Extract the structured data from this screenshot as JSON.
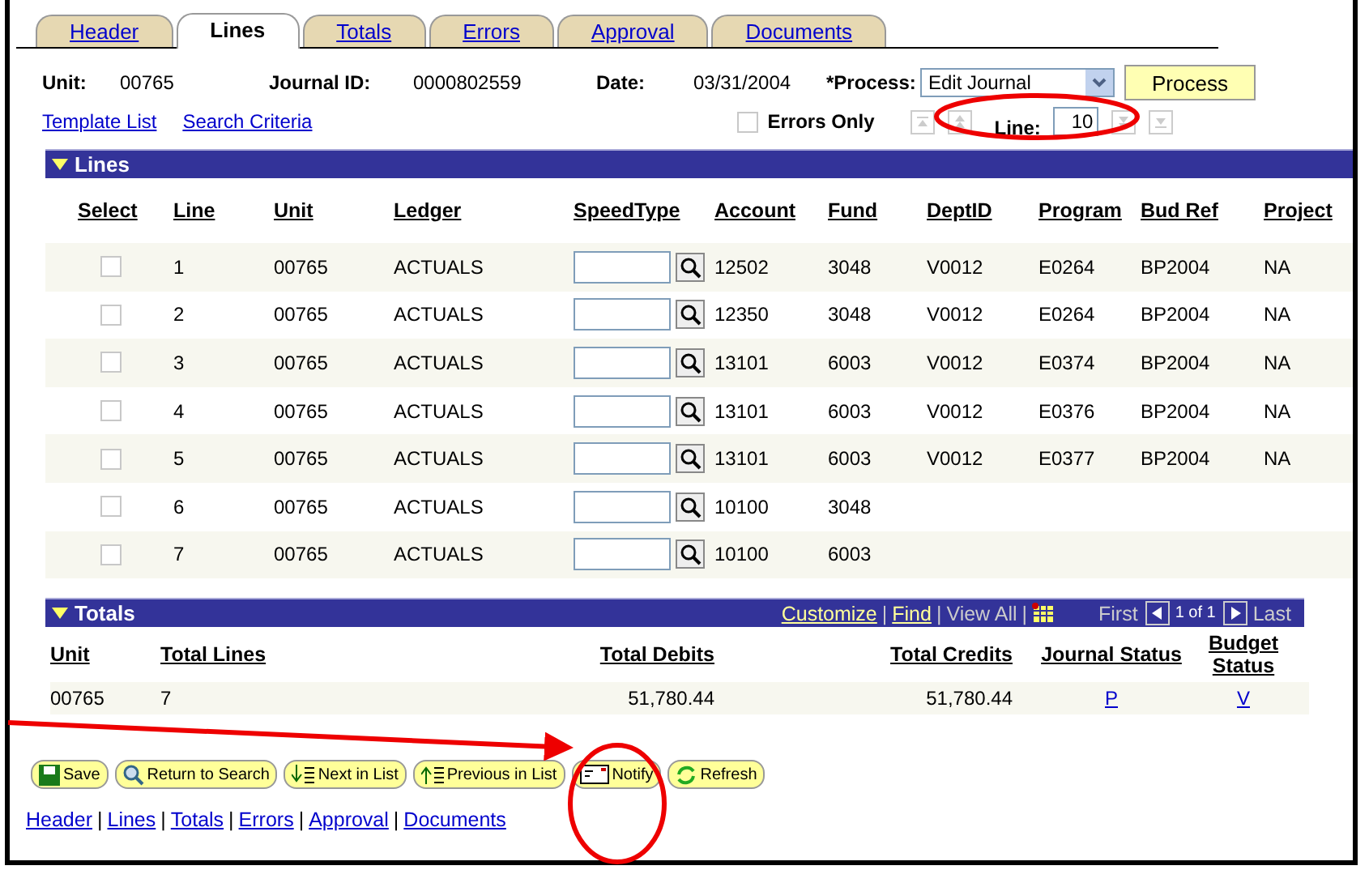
{
  "tabs": [
    {
      "label": "Header",
      "selected": false
    },
    {
      "label": "Lines",
      "selected": true
    },
    {
      "label": "Totals",
      "selected": false
    },
    {
      "label": "Errors",
      "selected": false
    },
    {
      "label": "Approval",
      "selected": false
    },
    {
      "label": "Documents",
      "selected": false
    }
  ],
  "header": {
    "unit_label": "Unit:",
    "unit": "00765",
    "journal_label": "Journal ID:",
    "journal_id": "0000802559",
    "date_label": "Date:",
    "date": "03/31/2004",
    "process_label": "*Process:",
    "process_value": "Edit Journal",
    "process_button": "Process"
  },
  "links": [
    "Template List",
    "Search Criteria"
  ],
  "errors_only": {
    "label": "Errors Only",
    "checked": false
  },
  "line_nav": {
    "label": "Line:",
    "value": "10"
  },
  "lines": {
    "title": "Lines",
    "columns": [
      "Select",
      "Line",
      "Unit",
      "Ledger",
      "SpeedType",
      "Account",
      "Fund",
      "DeptID",
      "Program",
      "Bud Ref",
      "Project"
    ],
    "rows": [
      {
        "selected": false,
        "line": "1",
        "unit": "00765",
        "ledger": "ACTUALS",
        "account": "12502",
        "fund": "3048",
        "dept": "V0012",
        "program": "E0264",
        "budref": "BP2004",
        "project": "NA"
      },
      {
        "selected": false,
        "line": "2",
        "unit": "00765",
        "ledger": "ACTUALS",
        "account": "12350",
        "fund": "3048",
        "dept": "V0012",
        "program": "E0264",
        "budref": "BP2004",
        "project": "NA"
      },
      {
        "selected": false,
        "line": "3",
        "unit": "00765",
        "ledger": "ACTUALS",
        "account": "13101",
        "fund": "6003",
        "dept": "V0012",
        "program": "E0374",
        "budref": "BP2004",
        "project": "NA"
      },
      {
        "selected": false,
        "line": "4",
        "unit": "00765",
        "ledger": "ACTUALS",
        "account": "13101",
        "fund": "6003",
        "dept": "V0012",
        "program": "E0376",
        "budref": "BP2004",
        "project": "NA"
      },
      {
        "selected": false,
        "line": "5",
        "unit": "00765",
        "ledger": "ACTUALS",
        "account": "13101",
        "fund": "6003",
        "dept": "V0012",
        "program": "E0377",
        "budref": "BP2004",
        "project": "NA"
      },
      {
        "selected": false,
        "line": "6",
        "unit": "00765",
        "ledger": "ACTUALS",
        "account": "10100",
        "fund": "3048"
      },
      {
        "selected": false,
        "line": "7",
        "unit": "00765",
        "ledger": "ACTUALS",
        "account": "10100",
        "fund": "6003"
      }
    ]
  },
  "totals": {
    "title": "Totals",
    "customize": "Customize",
    "find": "Find",
    "view_all": "View All",
    "first": "First",
    "count": "1 of 1",
    "last": "Last",
    "separator": "|",
    "columns": [
      "Unit",
      "Total Lines",
      "Total Debits",
      "Total Credits",
      "Journal Status",
      "Budget Status"
    ],
    "row": [
      "00765",
      "7",
      "51,780.44",
      "51,780.44",
      "P",
      "V"
    ]
  },
  "buttons": [
    {
      "kind": "save",
      "label": "Save"
    },
    {
      "kind": "search",
      "label": "Return to Search"
    },
    {
      "kind": "next",
      "label": "Next in List"
    },
    {
      "kind": "prev",
      "label": "Previous in List"
    },
    {
      "kind": "notify",
      "label": "Notify"
    },
    {
      "kind": "refresh",
      "label": "Refresh"
    }
  ],
  "footer_separator": "|",
  "footer_links": [
    "Header",
    "Lines",
    "Totals",
    "Errors",
    "Approval",
    "Documents"
  ]
}
